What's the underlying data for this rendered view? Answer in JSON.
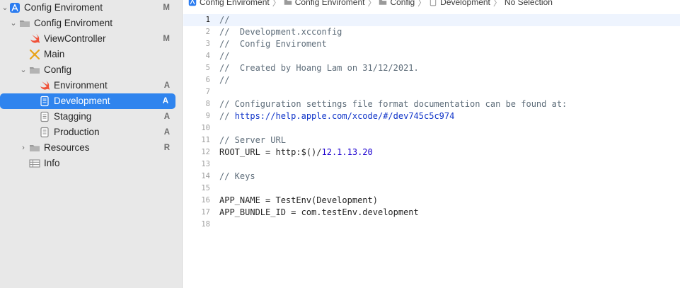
{
  "breadcrumb": [
    "Config Enviroment",
    "Config Enviroment",
    "Config",
    "Development",
    "No Selection"
  ],
  "sidebar": {
    "items": [
      {
        "label": "Config Enviroment",
        "badge": "M",
        "icon": "app-project-icon"
      },
      {
        "label": "Config Enviroment",
        "badge": "",
        "icon": "folder-icon"
      },
      {
        "label": "ViewController",
        "badge": "M",
        "icon": "swift-icon"
      },
      {
        "label": "Main",
        "badge": "",
        "icon": "storyboard-icon"
      },
      {
        "label": "Config",
        "badge": "",
        "icon": "folder-icon"
      },
      {
        "label": "Environment",
        "badge": "A",
        "icon": "swift-icon"
      },
      {
        "label": "Development",
        "badge": "A",
        "icon": "document-icon"
      },
      {
        "label": "Stagging",
        "badge": "A",
        "icon": "document-icon"
      },
      {
        "label": "Production",
        "badge": "A",
        "icon": "document-icon"
      },
      {
        "label": "Resources",
        "badge": "R",
        "icon": "folder-icon"
      },
      {
        "label": "Info",
        "badge": "",
        "icon": "plist-table-icon"
      }
    ]
  },
  "editor": {
    "current_line": "1",
    "lines": [
      {
        "n": "1",
        "t": "//"
      },
      {
        "n": "2",
        "t": "//  Development.xcconfig"
      },
      {
        "n": "3",
        "t": "//  Config Enviroment"
      },
      {
        "n": "4",
        "t": "//"
      },
      {
        "n": "5",
        "t": "//  Created by Hoang Lam on 31/12/2021."
      },
      {
        "n": "6",
        "t": "//"
      },
      {
        "n": "7",
        "t": ""
      },
      {
        "n": "8",
        "t": "// Configuration settings file format documentation can be found at:"
      },
      {
        "n": "9",
        "t": "// ",
        "link": "https://help.apple.com/xcode/#/dev745c5c974"
      },
      {
        "n": "10",
        "t": ""
      },
      {
        "n": "11",
        "t": "// Server URL"
      },
      {
        "n": "12",
        "t": "ROOT_URL = http:$()/",
        "numtail": "12.1.13.20"
      },
      {
        "n": "13",
        "t": ""
      },
      {
        "n": "14",
        "t": "// Keys"
      },
      {
        "n": "15",
        "t": ""
      },
      {
        "n": "16",
        "t": "APP_NAME = TestEnv(Development)"
      },
      {
        "n": "17",
        "t": "APP_BUNDLE_ID = com.testEnv.development"
      },
      {
        "n": "18",
        "t": ""
      }
    ]
  },
  "colors": {
    "selection": "#2f84ee",
    "comment": "#5d6c79",
    "link": "#0f34c9",
    "number": "#1c00cf",
    "swift": "#f05138"
  }
}
